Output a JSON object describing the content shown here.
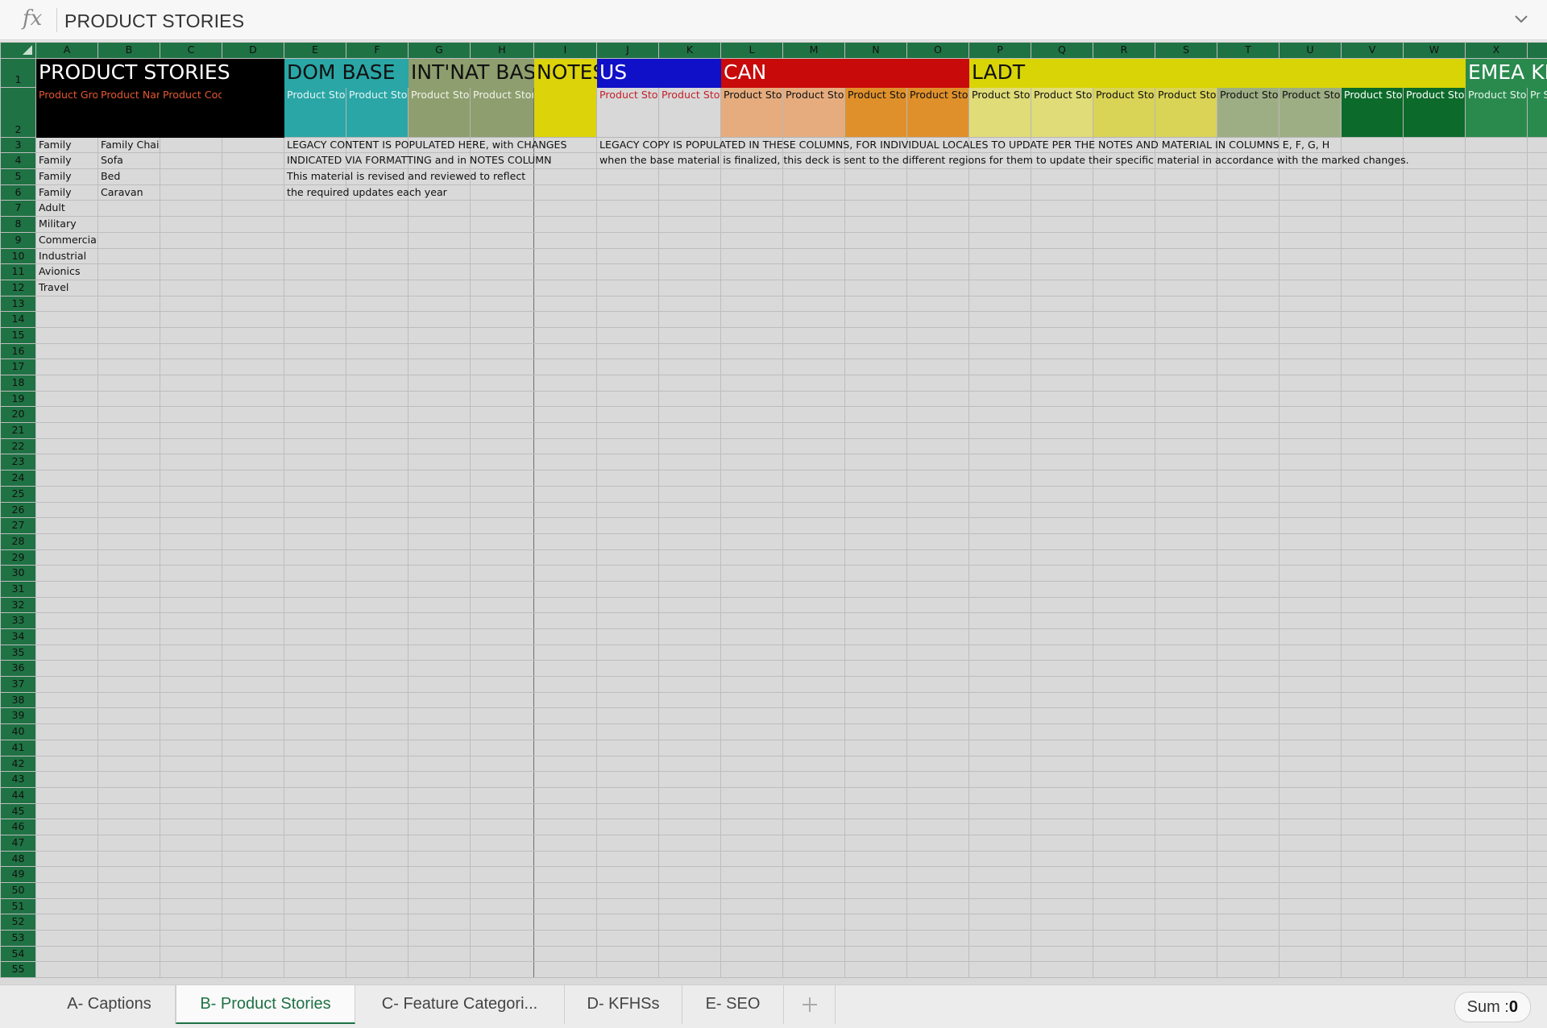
{
  "formula_bar": {
    "fx_label": "fx",
    "value": "PRODUCT STORIES"
  },
  "columns": [
    "A",
    "B",
    "C",
    "D",
    "E",
    "F",
    "G",
    "H",
    "I",
    "J",
    "K",
    "L",
    "M",
    "N",
    "O",
    "P",
    "Q",
    "R",
    "S",
    "T",
    "U",
    "V",
    "W",
    "X",
    ""
  ],
  "header_row": {
    "product_stories": "PRODUCT STORIES",
    "dom_base": "DOM BASE",
    "intnat_base": "INT'NAT BASE",
    "notes": "NOTES",
    "us": "US",
    "can": "CAN",
    "ladt": "LADT",
    "emea": "EMEA KF-"
  },
  "subheaders": [
    "Product Group Name",
    "Product Name",
    "Product Code",
    "",
    "Product Story Title (DOM)",
    "Product Story Desc (DOM)",
    "Product Story Title (INT'NAT)",
    "Product Story Desc (INT'NAT)",
    "",
    "Product Story Title (en_US)",
    "Product Story Desc (en_US)",
    "Product Story Title (en_CA)",
    "Product Story Desc (en_CA)",
    "Product Story Title (fr_CA)",
    "Product Story Desc (fr_CA)",
    "Product Story Title (es_MX)",
    "Product Story Desc (es_MX)",
    "Product Story Title (es_PR)",
    "Product Story Desc (es_PR)",
    "Product Story Title (es_XX)",
    "Product Story Desc (es_XX)",
    "Product Story Title (pt_BR)",
    "Product Story Desc (pt_BR)",
    "Product Story Title (en_GB)",
    "Pr St (e"
  ],
  "rows": [
    {
      "num": "3",
      "A": "Family",
      "B": "Family Chair",
      "E": "LEGACY CONTENT IS POPULATED HERE, with CHANGES",
      "J": "LEGACY COPY IS POPULATED IN THESE COLUMNS, FOR INDIVIDUAL LOCALES TO UPDATE PER THE NOTES AND MATERIAL IN COLUMNS E, F, G, H"
    },
    {
      "num": "4",
      "A": "Family",
      "B": "Sofa",
      "E": "INDICATED VIA FORMATTING and in NOTES COLUMN",
      "J": "when the base material is finalized, this deck is sent to the different regions for them to update their specific material in accordance with the marked changes."
    },
    {
      "num": "5",
      "A": "Family",
      "B": "Bed",
      "E": "This material is revised and reviewed to reflect",
      "J": ""
    },
    {
      "num": "6",
      "A": "Family",
      "B": "Caravan",
      "E": "the required updates each year",
      "J": ""
    },
    {
      "num": "7",
      "A": "Adult",
      "B": "",
      "E": "",
      "J": ""
    },
    {
      "num": "8",
      "A": "Military",
      "B": "",
      "E": "",
      "J": ""
    },
    {
      "num": "9",
      "A": "Commercial",
      "B": "",
      "E": "",
      "J": ""
    },
    {
      "num": "10",
      "A": "Industrial",
      "B": "",
      "E": "",
      "J": ""
    },
    {
      "num": "11",
      "A": "Avionics",
      "B": "",
      "E": "",
      "J": ""
    },
    {
      "num": "12",
      "A": "Travel",
      "B": "",
      "E": "",
      "J": ""
    }
  ],
  "row_numbers_header": [
    "1",
    "2"
  ],
  "empty_rows": [
    "13",
    "14",
    "15",
    "16",
    "17",
    "18",
    "19",
    "20",
    "21",
    "22",
    "23",
    "24",
    "25",
    "26",
    "27",
    "28",
    "29",
    "30",
    "31",
    "32",
    "33",
    "34",
    "35",
    "36",
    "37",
    "38",
    "39",
    "40",
    "41",
    "42",
    "43",
    "44",
    "45",
    "46",
    "47",
    "48",
    "49",
    "50",
    "51",
    "52",
    "53",
    "54",
    "55"
  ],
  "sheet_tabs": [
    "A- Captions",
    "B- Product Stories",
    "C- Feature Categori...",
    "D- KFHSs",
    "E- SEO"
  ],
  "active_tab": 1,
  "status": {
    "sum_label": "Sum :",
    "sum_value": "0"
  },
  "colors": {
    "header_green": "#1f7244",
    "black": "#000000",
    "teal": "#2aa6a6",
    "sage": "#8e9e6e",
    "yellow": "#dcd30a",
    "us_blue": "#1010c8",
    "can_red": "#c80a0a",
    "ladt_yellow": "#d9d406",
    "emea_green": "#2a8a4e",
    "subheader_red_text": "#e4572e"
  },
  "icons": {
    "formula_expand": "chevron-down-icon",
    "add_sheet": "plus-icon"
  }
}
